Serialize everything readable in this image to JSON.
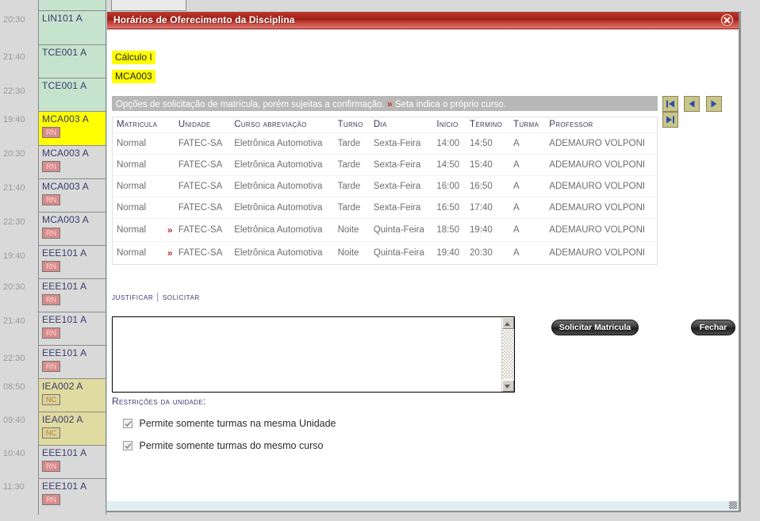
{
  "schedule": {
    "time_labels": [
      "20:30",
      "21:40",
      "22:30",
      "19:40",
      "20:30",
      "21:40",
      "22:30",
      "19:40",
      "20:30",
      "21:40",
      "22:30",
      "08:50",
      "09:40",
      "10:40",
      "11:30"
    ],
    "slots": [
      {
        "code": "LIN101 A",
        "badge": "",
        "style": "green"
      },
      {
        "code": "TCE001 A",
        "badge": "",
        "style": "green"
      },
      {
        "code": "TCE001 A",
        "badge": "",
        "style": "green"
      },
      {
        "code": "MCA003 A",
        "badge": "RN",
        "style": "yellow"
      },
      {
        "code": "MCA003 A",
        "badge": "RN",
        "style": "plain"
      },
      {
        "code": "MCA003 A",
        "badge": "RN",
        "style": "plain"
      },
      {
        "code": "MCA003 A",
        "badge": "RN",
        "style": "plain"
      },
      {
        "code": "EEE101 A",
        "badge": "RN",
        "style": "plain"
      },
      {
        "code": "EEE101 A",
        "badge": "RN",
        "style": "plain"
      },
      {
        "code": "EEE101 A",
        "badge": "RN",
        "style": "plain"
      },
      {
        "code": "EEE101 A",
        "badge": "RN",
        "style": "plain"
      },
      {
        "code": "IEA002 A",
        "badge": "NC",
        "style": "khaki"
      },
      {
        "code": "IEA002 A",
        "badge": "NC",
        "style": "khaki"
      },
      {
        "code": "EEE101 A",
        "badge": "RN",
        "style": "plain"
      },
      {
        "code": "EEE101 A",
        "badge": "RN",
        "style": "plain"
      }
    ]
  },
  "dialog": {
    "title": "Horários de Oferecimento da Disciplina",
    "close_icon": "close-icon",
    "course_name": "Cálculo I",
    "course_code": "MCA003",
    "info_text_before": "Opções de solicitação de matrícula, porém sujeitas a confirmação.",
    "info_arrow": "»",
    "info_text_after": "Seta indica o próprio curso.",
    "pager": [
      {
        "name": "first-page-button",
        "icon": "first-page-icon"
      },
      {
        "name": "previous-page-button",
        "icon": "previous-page-icon"
      },
      {
        "name": "next-page-button",
        "icon": "next-page-icon"
      },
      {
        "name": "last-page-button",
        "icon": "last-page-icon"
      }
    ],
    "table": {
      "headers": [
        "Matricula",
        "Unidade",
        "Curso Abreviação",
        "Turno",
        "Dia",
        "Início",
        "Término",
        "Turma",
        "Professor"
      ],
      "rows": [
        {
          "matricula": "Normal",
          "arrow": "",
          "unidade": "FATEC-SA",
          "curso": "Eletrônica Automotiva",
          "turno": "Tarde",
          "dia": "Sexta-Feira",
          "inicio": "14:00",
          "termino": "14:50",
          "turma": "A",
          "professor": "ADEMAURO VOLPONI"
        },
        {
          "matricula": "Normal",
          "arrow": "",
          "unidade": "FATEC-SA",
          "curso": "Eletrônica Automotiva",
          "turno": "Tarde",
          "dia": "Sexta-Feira",
          "inicio": "14:50",
          "termino": "15:40",
          "turma": "A",
          "professor": "ADEMAURO VOLPONI"
        },
        {
          "matricula": "Normal",
          "arrow": "",
          "unidade": "FATEC-SA",
          "curso": "Eletrônica Automotiva",
          "turno": "Tarde",
          "dia": "Sexta-Feira",
          "inicio": "16:00",
          "termino": "16:50",
          "turma": "A",
          "professor": "ADEMAURO VOLPONI"
        },
        {
          "matricula": "Normal",
          "arrow": "",
          "unidade": "FATEC-SA",
          "curso": "Eletrônica Automotiva",
          "turno": "Tarde",
          "dia": "Sexta-Feira",
          "inicio": "16:50",
          "termino": "17:40",
          "turma": "A",
          "professor": "ADEMAURO VOLPONI"
        },
        {
          "matricula": "Normal",
          "arrow": "»",
          "unidade": "FATEC-SA",
          "curso": "Eletrônica Automotiva",
          "turno": "Noite",
          "dia": "Quinta-Feira",
          "inicio": "18:50",
          "termino": "19:40",
          "turma": "A",
          "professor": "ADEMAURO VOLPONI"
        },
        {
          "matricula": "Normal",
          "arrow": "»",
          "unidade": "FATEC-SA",
          "curso": "Eletrônica Automotiva",
          "turno": "Noite",
          "dia": "Quinta-Feira",
          "inicio": "19:40",
          "termino": "20:30",
          "turma": "A",
          "professor": "ADEMAURO VOLPONI"
        }
      ]
    },
    "links": {
      "justificar": "JUSTIFICAR",
      "separator": "|",
      "solicitar": "SOLICITAR"
    },
    "justification_textarea": {
      "value": "",
      "placeholder": ""
    },
    "buttons": {
      "solicitar_matricula": "Solicitar Matricula",
      "fechar": "Fechar"
    },
    "restrictions": {
      "title": "Restrições da Unidade:",
      "items": [
        {
          "label": "Permite somente turmas na mesma Unidade",
          "checked": true
        },
        {
          "label": "Permite somente turmas do mesmo curso",
          "checked": true
        }
      ]
    }
  },
  "colors": {
    "title_bar": "#a82218",
    "accent_red": "#b93232",
    "highlight_yellow": "#ffff00",
    "slot_green": "#c5e3cd",
    "slot_khaki": "#e0dba0",
    "link_navy": "#3a3a72",
    "pager_khaki": "#c9c589"
  }
}
